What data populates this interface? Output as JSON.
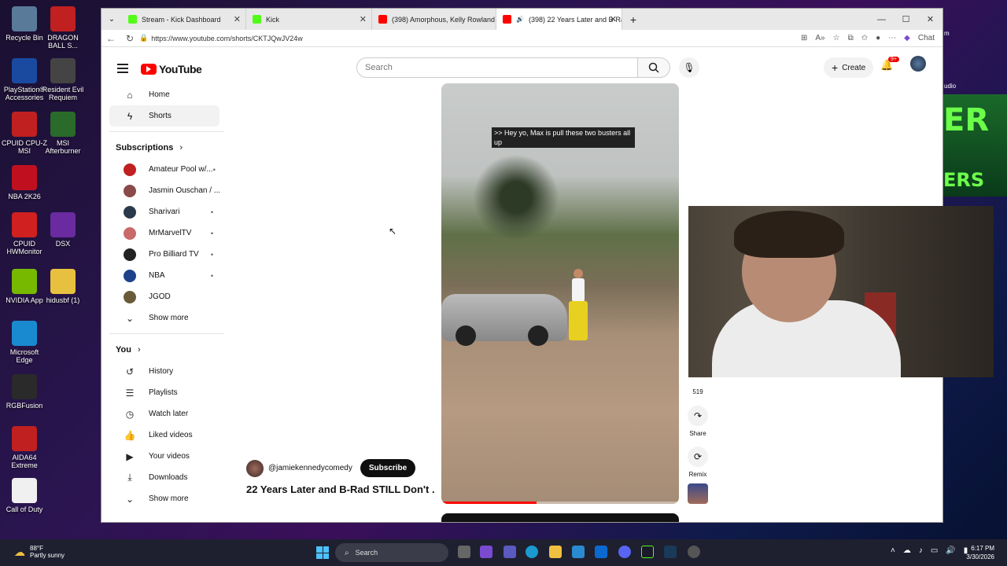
{
  "desktop": {
    "icons": [
      {
        "label": "Recycle Bin",
        "color": "#5a7a9a"
      },
      {
        "label": "DRAGON BALL S...",
        "color": "#c02020"
      },
      {
        "label": "PlayStation® Accessories",
        "color": "#1a4aa0"
      },
      {
        "label": "Resident Evil Requiem",
        "color": "#444444"
      },
      {
        "label": "CPUID CPU-Z MSI",
        "color": "#c02020"
      },
      {
        "label": "MSI Afterburner",
        "color": "#2a6a2a"
      },
      {
        "label": "NBA 2K26",
        "color": "#c01020"
      },
      {
        "label": "CPUID HWMonitor",
        "color": "#d02020"
      },
      {
        "label": "DSX",
        "color": "#6a2aa0"
      },
      {
        "label": "NVIDIA App",
        "color": "#76b900"
      },
      {
        "label": "hidusbf (1)",
        "color": "#e8c040"
      },
      {
        "label": "Microsoft Edge",
        "color": "#1a8ad0"
      },
      {
        "label": "RGBFusion",
        "color": "#2a2a2a"
      },
      {
        "label": "AIDA64 Extreme",
        "color": "#c02020"
      },
      {
        "label": "Call of Duty",
        "color": "#f0f0f0"
      }
    ],
    "right_labels": [
      "m",
      "udio"
    ]
  },
  "browser": {
    "tabs": [
      {
        "title": "Stream - Kick Dashboard",
        "favicon_color": "#53fc18"
      },
      {
        "title": "Kick",
        "favicon_color": "#53fc18"
      },
      {
        "title": "(398) Amorphous, Kelly Rowland &",
        "favicon_color": "#ff0000"
      },
      {
        "title": "(398) 22 Years Later and B-Rad",
        "favicon_color": "#ff0000"
      }
    ],
    "url": "https://www.youtube.com/shorts/CKTJQwJV24w",
    "chat_label": "Chat"
  },
  "youtube": {
    "logo_text": "YouTube",
    "search_placeholder": "Search",
    "create_label": "Create",
    "notif_badge": "9+",
    "sidebar": {
      "main": [
        {
          "label": "Home",
          "icon": "home-icon"
        },
        {
          "label": "Shorts",
          "icon": "shorts-icon"
        }
      ],
      "subscriptions_title": "Subscriptions",
      "subscriptions": [
        {
          "label": "Amateur Pool w/...",
          "color": "#c02020",
          "dot": true
        },
        {
          "label": "Jasmin Ouschan / ...",
          "color": "#8a4a4a",
          "dot": false
        },
        {
          "label": "Sharivari",
          "color": "#2a3a4a",
          "dot": true
        },
        {
          "label": "MrMarvelTV",
          "color": "#c86a6a",
          "dot": true
        },
        {
          "label": "Pro Billiard TV",
          "color": "#222222",
          "dot": true
        },
        {
          "label": "NBA",
          "color": "#1d428a",
          "dot": true
        },
        {
          "label": "JGOD",
          "color": "#6a5a3a",
          "dot": false
        }
      ],
      "show_more": "Show more",
      "you_title": "You",
      "you_items": [
        {
          "label": "History",
          "icon": "history-icon"
        },
        {
          "label": "Playlists",
          "icon": "playlists-icon"
        },
        {
          "label": "Watch later",
          "icon": "watch-later-icon"
        },
        {
          "label": "Liked videos",
          "icon": "like-icon"
        },
        {
          "label": "Your videos",
          "icon": "your-videos-icon"
        },
        {
          "label": "Downloads",
          "icon": "download-icon"
        }
      ],
      "show_more_2": "Show more"
    },
    "short": {
      "caption": ">> Hey yo, Max is pull these two busters all up",
      "channel": "@jamiekennedycomedy",
      "subscribe": "Subscribe",
      "title": "22 Years Later and B-Rad STILL Don't ...",
      "progress": 0.4
    },
    "actions": {
      "comments_count": "519",
      "share_label": "Share",
      "remix_label": "Remix"
    }
  },
  "taskbar": {
    "temperature": "88°F",
    "weather": "Partly sunny",
    "search_label": "Search",
    "time": "6:17 PM",
    "date": "3/30/2026"
  }
}
